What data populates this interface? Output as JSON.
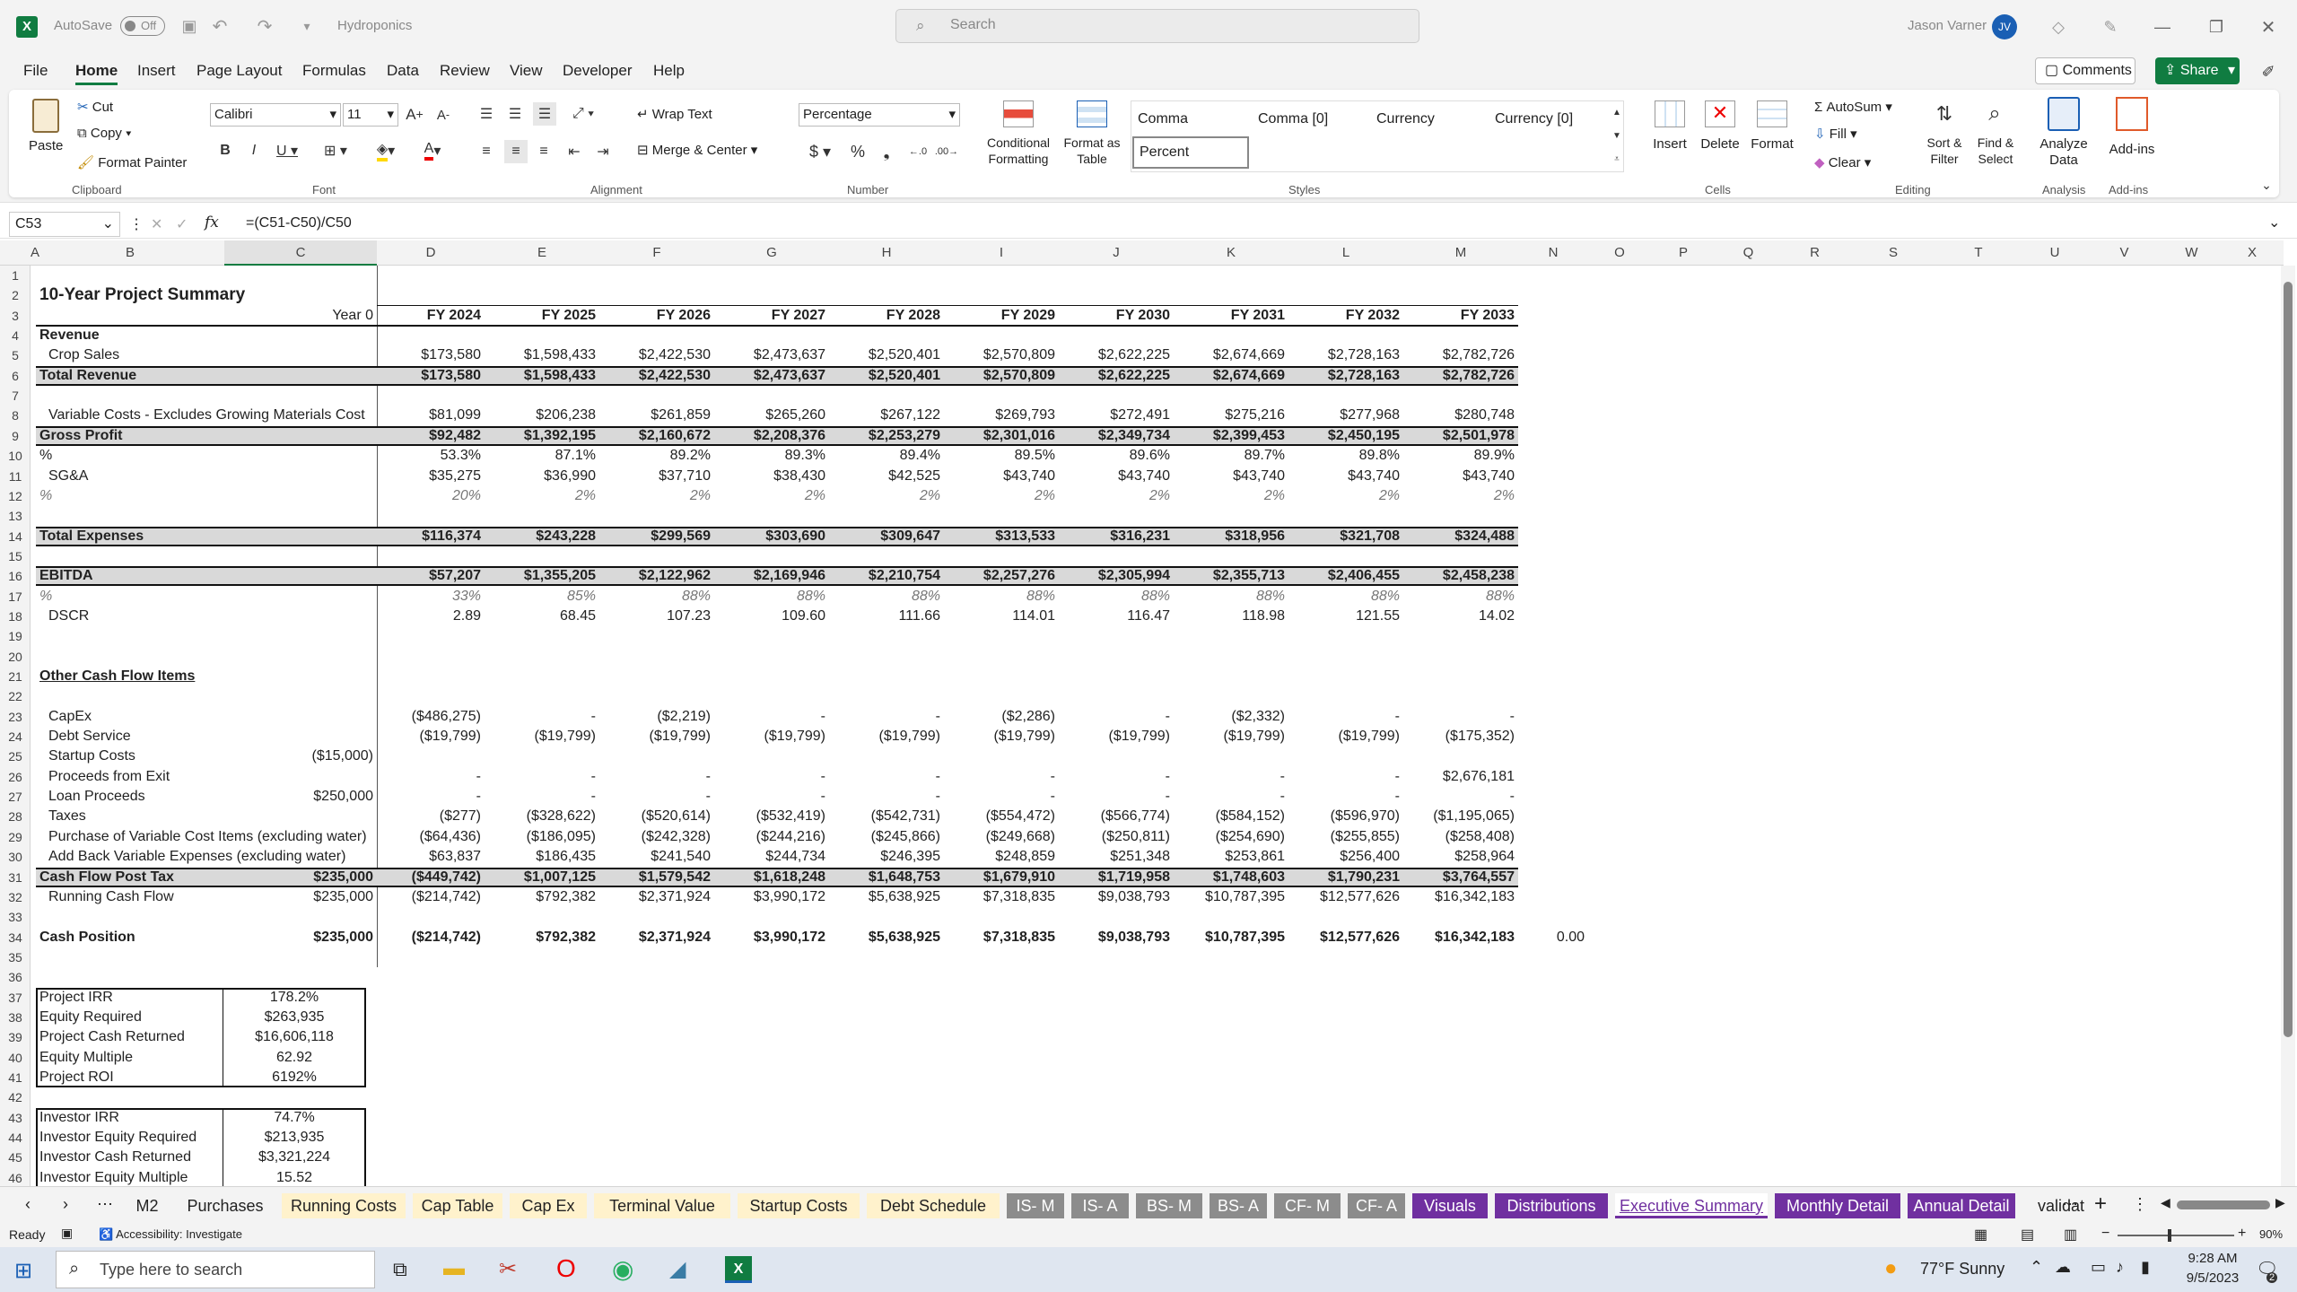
{
  "titlebar": {
    "autosave": "AutoSave",
    "autosave_state": "Off",
    "filename": "Hydroponics",
    "search_placeholder": "Search",
    "user": "Jason Varner",
    "initials": "JV"
  },
  "menu": [
    "File",
    "Home",
    "Insert",
    "Page Layout",
    "Formulas",
    "Data",
    "Review",
    "View",
    "Developer",
    "Help"
  ],
  "menu_right": {
    "comments": "Comments",
    "share": "Share"
  },
  "ribbon": {
    "clipboard": {
      "paste": "Paste",
      "cut": "Cut",
      "copy": "Copy",
      "format_painter": "Format Painter",
      "group": "Clipboard"
    },
    "font": {
      "name": "Calibri",
      "size": "11",
      "group": "Font"
    },
    "alignment": {
      "wrap": "Wrap Text",
      "merge": "Merge & Center",
      "group": "Alignment"
    },
    "number": {
      "format": "Percentage",
      "group": "Number"
    },
    "styles": {
      "cf": "Conditional Formatting",
      "fat": "Format as Table",
      "s1": "Comma",
      "s2": "Comma [0]",
      "s3": "Currency",
      "s4": "Currency [0]",
      "s5": "Percent",
      "group": "Styles"
    },
    "cells": {
      "insert": "Insert",
      "delete": "Delete",
      "format": "Format",
      "group": "Cells"
    },
    "editing": {
      "autosum": "AutoSum",
      "fill": "Fill",
      "clear": "Clear",
      "sort": "Sort & Filter",
      "find": "Find & Select",
      "group": "Editing"
    },
    "analysis": {
      "analyze": "Analyze Data",
      "group": "Analysis"
    },
    "addins": {
      "addins": "Add-ins",
      "group": "Add-ins"
    }
  },
  "formula_bar": {
    "name_box": "C53",
    "fx": "fx",
    "formula": "=(C51-C50)/C50"
  },
  "columns": [
    "A",
    "B",
    "C",
    "D",
    "E",
    "F",
    "G",
    "H",
    "I",
    "J",
    "K",
    "L",
    "M",
    "N",
    "O",
    "P",
    "Q",
    "R",
    "S",
    "T",
    "U",
    "V",
    "W",
    "X"
  ],
  "rows": [
    "1",
    "2",
    "3",
    "4",
    "5",
    "6",
    "7",
    "8",
    "9",
    "10",
    "11",
    "12",
    "13",
    "14",
    "15",
    "16",
    "17",
    "18",
    "19",
    "20",
    "21",
    "22",
    "23",
    "24",
    "25",
    "26",
    "27",
    "28",
    "29",
    "30",
    "31",
    "32",
    "33",
    "34",
    "35",
    "36",
    "37",
    "38",
    "39",
    "40",
    "41",
    "42",
    "43",
    "44",
    "45",
    "46"
  ],
  "sheet": {
    "title": "10-Year Project Summary",
    "year0": "Year 0",
    "years": [
      "FY 2024",
      "FY 2025",
      "FY 2026",
      "FY 2027",
      "FY 2028",
      "FY 2029",
      "FY 2030",
      "FY 2031",
      "FY 2032",
      "FY 2033"
    ],
    "lines": [
      {
        "row": 4,
        "label": "Revenue",
        "bold": true,
        "values": []
      },
      {
        "row": 5,
        "label": "Crop Sales",
        "indent": true,
        "values": [
          "$173,580",
          "$1,598,433",
          "$2,422,530",
          "$2,473,637",
          "$2,520,401",
          "$2,570,809",
          "$2,622,225",
          "$2,674,669",
          "$2,728,163",
          "$2,782,726"
        ]
      },
      {
        "row": 6,
        "label": "Total Revenue",
        "bold": true,
        "boxed": true,
        "values": [
          "$173,580",
          "$1,598,433",
          "$2,422,530",
          "$2,473,637",
          "$2,520,401",
          "$2,570,809",
          "$2,622,225",
          "$2,674,669",
          "$2,728,163",
          "$2,782,726"
        ]
      },
      {
        "row": 8,
        "label": "Variable Costs - Excludes Growing Materials Cost",
        "indent": true,
        "values": [
          "$81,099",
          "$206,238",
          "$261,859",
          "$265,260",
          "$267,122",
          "$269,793",
          "$272,491",
          "$275,216",
          "$277,968",
          "$280,748"
        ]
      },
      {
        "row": 9,
        "label": "Gross Profit",
        "bold": true,
        "boxed": true,
        "values": [
          "$92,482",
          "$1,392,195",
          "$2,160,672",
          "$2,208,376",
          "$2,253,279",
          "$2,301,016",
          "$2,349,734",
          "$2,399,453",
          "$2,450,195",
          "$2,501,978"
        ]
      },
      {
        "row": 10,
        "label": "%",
        "values": [
          "53.3%",
          "87.1%",
          "89.2%",
          "89.3%",
          "89.4%",
          "89.5%",
          "89.6%",
          "89.7%",
          "89.8%",
          "89.9%"
        ]
      },
      {
        "row": 11,
        "label": "SG&A",
        "indent": true,
        "values": [
          "$35,275",
          "$36,990",
          "$37,710",
          "$38,430",
          "$42,525",
          "$43,740",
          "$43,740",
          "$43,740",
          "$43,740",
          "$43,740"
        ]
      },
      {
        "row": 12,
        "label": "%",
        "italic": true,
        "values": [
          "20%",
          "2%",
          "2%",
          "2%",
          "2%",
          "2%",
          "2%",
          "2%",
          "2%",
          "2%"
        ]
      },
      {
        "row": 14,
        "label": "Total Expenses",
        "bold": true,
        "boxed": true,
        "values": [
          "$116,374",
          "$243,228",
          "$299,569",
          "$303,690",
          "$309,647",
          "$313,533",
          "$316,231",
          "$318,956",
          "$321,708",
          "$324,488"
        ]
      },
      {
        "row": 16,
        "label": "EBITDA",
        "bold": true,
        "boxed": true,
        "values": [
          "$57,207",
          "$1,355,205",
          "$2,122,962",
          "$2,169,946",
          "$2,210,754",
          "$2,257,276",
          "$2,305,994",
          "$2,355,713",
          "$2,406,455",
          "$2,458,238"
        ]
      },
      {
        "row": 17,
        "label": "%",
        "italic": true,
        "values": [
          "33%",
          "85%",
          "88%",
          "88%",
          "88%",
          "88%",
          "88%",
          "88%",
          "88%",
          "88%"
        ]
      },
      {
        "row": 18,
        "label": "DSCR",
        "indent": true,
        "values": [
          "2.89",
          "68.45",
          "107.23",
          "109.60",
          "111.66",
          "114.01",
          "116.47",
          "118.98",
          "121.55",
          "14.02"
        ]
      },
      {
        "row": 21,
        "label": "Other Cash Flow Items",
        "bold": true,
        "underline": true,
        "values": []
      },
      {
        "row": 23,
        "label": "CapEx",
        "indent": true,
        "values": [
          "($486,275)",
          "-",
          "($2,219)",
          "-",
          "-",
          "($2,286)",
          "-",
          "($2,332)",
          "-",
          "-"
        ]
      },
      {
        "row": 24,
        "label": "Debt Service",
        "indent": true,
        "values": [
          "($19,799)",
          "($19,799)",
          "($19,799)",
          "($19,799)",
          "($19,799)",
          "($19,799)",
          "($19,799)",
          "($19,799)",
          "($19,799)",
          "($175,352)"
        ]
      },
      {
        "row": 25,
        "label": "Startup Costs",
        "indent": true,
        "c": "($15,000)",
        "values": []
      },
      {
        "row": 26,
        "label": "Proceeds from Exit",
        "indent": true,
        "values": [
          "-",
          "-",
          "-",
          "-",
          "-",
          "-",
          "-",
          "-",
          "-",
          "$2,676,181"
        ]
      },
      {
        "row": 27,
        "label": "Loan Proceeds",
        "indent": true,
        "c": "$250,000",
        "values": [
          "-",
          "-",
          "-",
          "-",
          "-",
          "-",
          "-",
          "-",
          "-",
          "-"
        ]
      },
      {
        "row": 28,
        "label": "Taxes",
        "indent": true,
        "values": [
          "($277)",
          "($328,622)",
          "($520,614)",
          "($532,419)",
          "($542,731)",
          "($554,472)",
          "($566,774)",
          "($584,152)",
          "($596,970)",
          "($1,195,065)"
        ]
      },
      {
        "row": 29,
        "label": "Purchase of Variable Cost Items (excluding water)",
        "indent": true,
        "values": [
          "($64,436)",
          "($186,095)",
          "($242,328)",
          "($244,216)",
          "($245,866)",
          "($249,668)",
          "($250,811)",
          "($254,690)",
          "($255,855)",
          "($258,408)"
        ]
      },
      {
        "row": 30,
        "label": "Add Back Variable Expenses (excluding water)",
        "indent": true,
        "values": [
          "$63,837",
          "$186,435",
          "$241,540",
          "$244,734",
          "$246,395",
          "$248,859",
          "$251,348",
          "$253,861",
          "$256,400",
          "$258,964"
        ]
      },
      {
        "row": 31,
        "label": "Cash Flow Post Tax",
        "bold": true,
        "boxed": true,
        "c": "$235,000",
        "values": [
          "($449,742)",
          "$1,007,125",
          "$1,579,542",
          "$1,618,248",
          "$1,648,753",
          "$1,679,910",
          "$1,719,958",
          "$1,748,603",
          "$1,790,231",
          "$3,764,557"
        ]
      },
      {
        "row": 32,
        "label": "Running Cash Flow",
        "indent": true,
        "c": "$235,000",
        "values": [
          "($214,742)",
          "$792,382",
          "$2,371,924",
          "$3,990,172",
          "$5,638,925",
          "$7,318,835",
          "$9,038,793",
          "$10,787,395",
          "$12,577,626",
          "$16,342,183"
        ]
      },
      {
        "row": 34,
        "label": "Cash Position",
        "bold": true,
        "c": "$235,000",
        "values": [
          "($214,742)",
          "$792,382",
          "$2,371,924",
          "$3,990,172",
          "$5,638,925",
          "$7,318,835",
          "$9,038,793",
          "$10,787,395",
          "$12,577,626",
          "$16,342,183"
        ],
        "n": "0.00"
      }
    ],
    "project_box": [
      {
        "label": "Project IRR",
        "value": "178.2%"
      },
      {
        "label": "Equity Required",
        "value": "$263,935"
      },
      {
        "label": "Project Cash Returned",
        "value": "$16,606,118"
      },
      {
        "label": "Equity Multiple",
        "value": "62.92"
      },
      {
        "label": "Project ROI",
        "value": "6192%"
      }
    ],
    "investor_box": [
      {
        "label": "Investor IRR",
        "value": "74.7%"
      },
      {
        "label": "Investor Equity Required",
        "value": "$213,935"
      },
      {
        "label": "Investor Cash Returned",
        "value": "$3,321,224"
      },
      {
        "label": "Investor Equity Multiple",
        "value": "15.52"
      }
    ]
  },
  "tabs": [
    {
      "label": "M2",
      "style": "plain"
    },
    {
      "label": "Purchases",
      "style": "plain"
    },
    {
      "label": "Running Costs",
      "style": "yellow"
    },
    {
      "label": "Cap Table",
      "style": "yellow"
    },
    {
      "label": "Cap Ex",
      "style": "yellow"
    },
    {
      "label": "Terminal Value",
      "style": "yellow"
    },
    {
      "label": "Startup Costs",
      "style": "yellow"
    },
    {
      "label": "Debt Schedule",
      "style": "yellow"
    },
    {
      "label": "IS- M",
      "style": "grey"
    },
    {
      "label": "IS- A",
      "style": "grey"
    },
    {
      "label": "BS- M",
      "style": "grey"
    },
    {
      "label": "BS- A",
      "style": "grey"
    },
    {
      "label": "CF- M",
      "style": "grey"
    },
    {
      "label": "CF- A",
      "style": "grey"
    },
    {
      "label": "Visuals",
      "style": "purple"
    },
    {
      "label": "Distributions",
      "style": "purple"
    },
    {
      "label": "Executive Summary",
      "style": "active"
    },
    {
      "label": "Monthly Detail",
      "style": "purple"
    },
    {
      "label": "Annual Detail",
      "style": "purple"
    },
    {
      "label": "validat",
      "style": "plain"
    }
  ],
  "status": {
    "ready": "Ready",
    "accessibility": "Accessibility: Investigate",
    "zoom": "90%"
  },
  "taskbar": {
    "search": "Type here to search",
    "weather": "77°F  Sunny",
    "time": "9:28 AM",
    "date": "9/5/2023",
    "notif": "2"
  }
}
